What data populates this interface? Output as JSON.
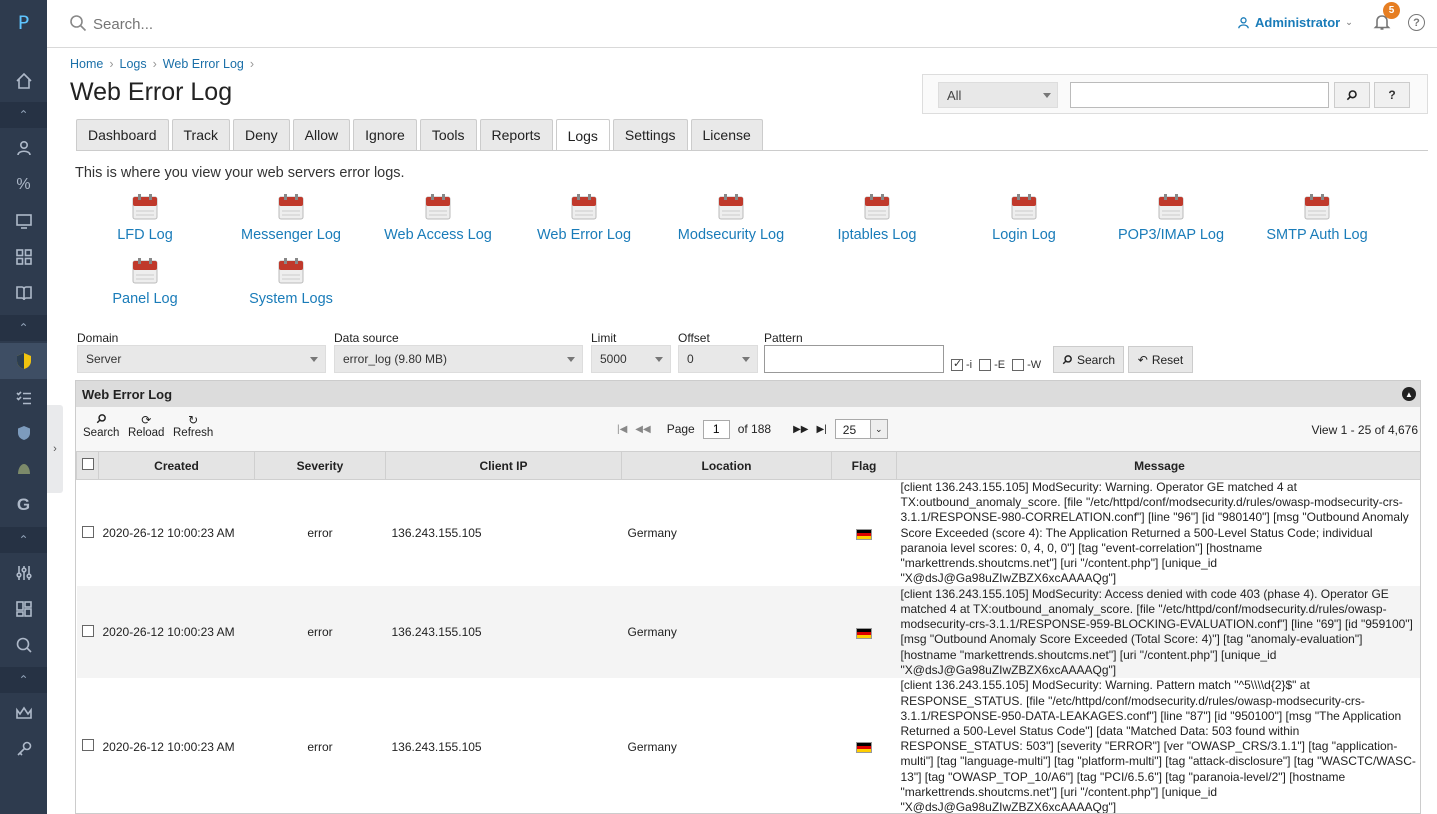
{
  "app": {
    "logo_letter": "P"
  },
  "topbar": {
    "search_placeholder": "Search...",
    "user": "Administrator",
    "notifications": "5",
    "help": "?"
  },
  "breadcrumb": [
    "Home",
    "Logs",
    "Web Error Log"
  ],
  "page_title": "Web Error Log",
  "global_search": {
    "scope": "All",
    "query": "",
    "search_btn": "⌕",
    "help_btn": "?"
  },
  "tabs": [
    "Dashboard",
    "Track",
    "Deny",
    "Allow",
    "Ignore",
    "Tools",
    "Reports",
    "Logs",
    "Settings",
    "License"
  ],
  "active_tab": "Logs",
  "intro": "This is where you view your web servers error logs.",
  "log_links": [
    "LFD Log",
    "Messenger Log",
    "Web Access Log",
    "Web Error Log",
    "Modsecurity Log",
    "Iptables Log",
    "Login Log",
    "POP3/IMAP Log",
    "SMTP Auth Log",
    "Panel Log",
    "System Logs"
  ],
  "filters": {
    "domain_label": "Domain",
    "domain_value": "Server",
    "source_label": "Data source",
    "source_value": "error_log (9.80 MB)",
    "limit_label": "Limit",
    "limit_value": "5000",
    "offset_label": "Offset",
    "offset_value": "0",
    "pattern_label": "Pattern",
    "pattern_value": "",
    "opt_i": "-i",
    "opt_e": "-E",
    "opt_w": "-W",
    "search_btn": "Search",
    "reset_btn": "Reset"
  },
  "grid": {
    "title": "Web Error Log",
    "tools": [
      "Search",
      "Reload",
      "Refresh"
    ],
    "page_label": "Page",
    "page": "1",
    "of_label": "of 188",
    "rows": "25",
    "view": "View 1 - 25 of 4,676",
    "columns": [
      "Created",
      "Severity",
      "Client IP",
      "Location",
      "Flag",
      "Message"
    ],
    "rows_data": [
      {
        "created": "2020-26-12 10:00:23 AM",
        "severity": "error",
        "ip": "136.243.155.105",
        "location": "Germany",
        "message": "[client 136.243.155.105] ModSecurity: Warning. Operator GE matched 4 at TX:outbound_anomaly_score. [file \"/etc/httpd/conf/modsecurity.d/rules/owasp-modsecurity-crs-3.1.1/RESPONSE-980-CORRELATION.conf\"] [line \"96\"] [id \"980140\"] [msg \"Outbound Anomaly Score Exceeded (score 4): The Application Returned a 500-Level Status Code; individual paranoia level scores: 0, 4, 0, 0\"] [tag \"event-correlation\"] [hostname \"markettrends.shoutcms.net\"] [uri \"/content.php\"] [unique_id \"X@dsJ@Ga98uZIwZBZX6xcAAAAQg\"]"
      },
      {
        "created": "2020-26-12 10:00:23 AM",
        "severity": "error",
        "ip": "136.243.155.105",
        "location": "Germany",
        "message": "[client 136.243.155.105] ModSecurity: Access denied with code 403 (phase 4). Operator GE matched 4 at TX:outbound_anomaly_score. [file \"/etc/httpd/conf/modsecurity.d/rules/owasp-modsecurity-crs-3.1.1/RESPONSE-959-BLOCKING-EVALUATION.conf\"] [line \"69\"] [id \"959100\"] [msg \"Outbound Anomaly Score Exceeded (Total Score: 4)\"] [tag \"anomaly-evaluation\"] [hostname \"markettrends.shoutcms.net\"] [uri \"/content.php\"] [unique_id \"X@dsJ@Ga98uZIwZBZX6xcAAAAQg\"]"
      },
      {
        "created": "2020-26-12 10:00:23 AM",
        "severity": "error",
        "ip": "136.243.155.105",
        "location": "Germany",
        "message": "[client 136.243.155.105] ModSecurity: Warning. Pattern match \"^5\\\\\\\\d{2}$\" at RESPONSE_STATUS. [file \"/etc/httpd/conf/modsecurity.d/rules/owasp-modsecurity-crs-3.1.1/RESPONSE-950-DATA-LEAKAGES.conf\"] [line \"87\"] [id \"950100\"] [msg \"The Application Returned a 500-Level Status Code\"] [data \"Matched Data: 503 found within RESPONSE_STATUS: 503\"] [severity \"ERROR\"] [ver \"OWASP_CRS/3.1.1\"] [tag \"application-multi\"] [tag \"language-multi\"] [tag \"platform-multi\"] [tag \"attack-disclosure\"] [tag \"WASCTC/WASC-13\"] [tag \"OWASP_TOP_10/A6\"] [tag \"PCI/6.5.6\"] [tag \"paranoia-level/2\"] [hostname \"markettrends.shoutcms.net\"] [uri \"/content.php\"] [unique_id \"X@dsJ@Ga98uZIwZBZX6xcAAAAQg\"]"
      }
    ]
  }
}
